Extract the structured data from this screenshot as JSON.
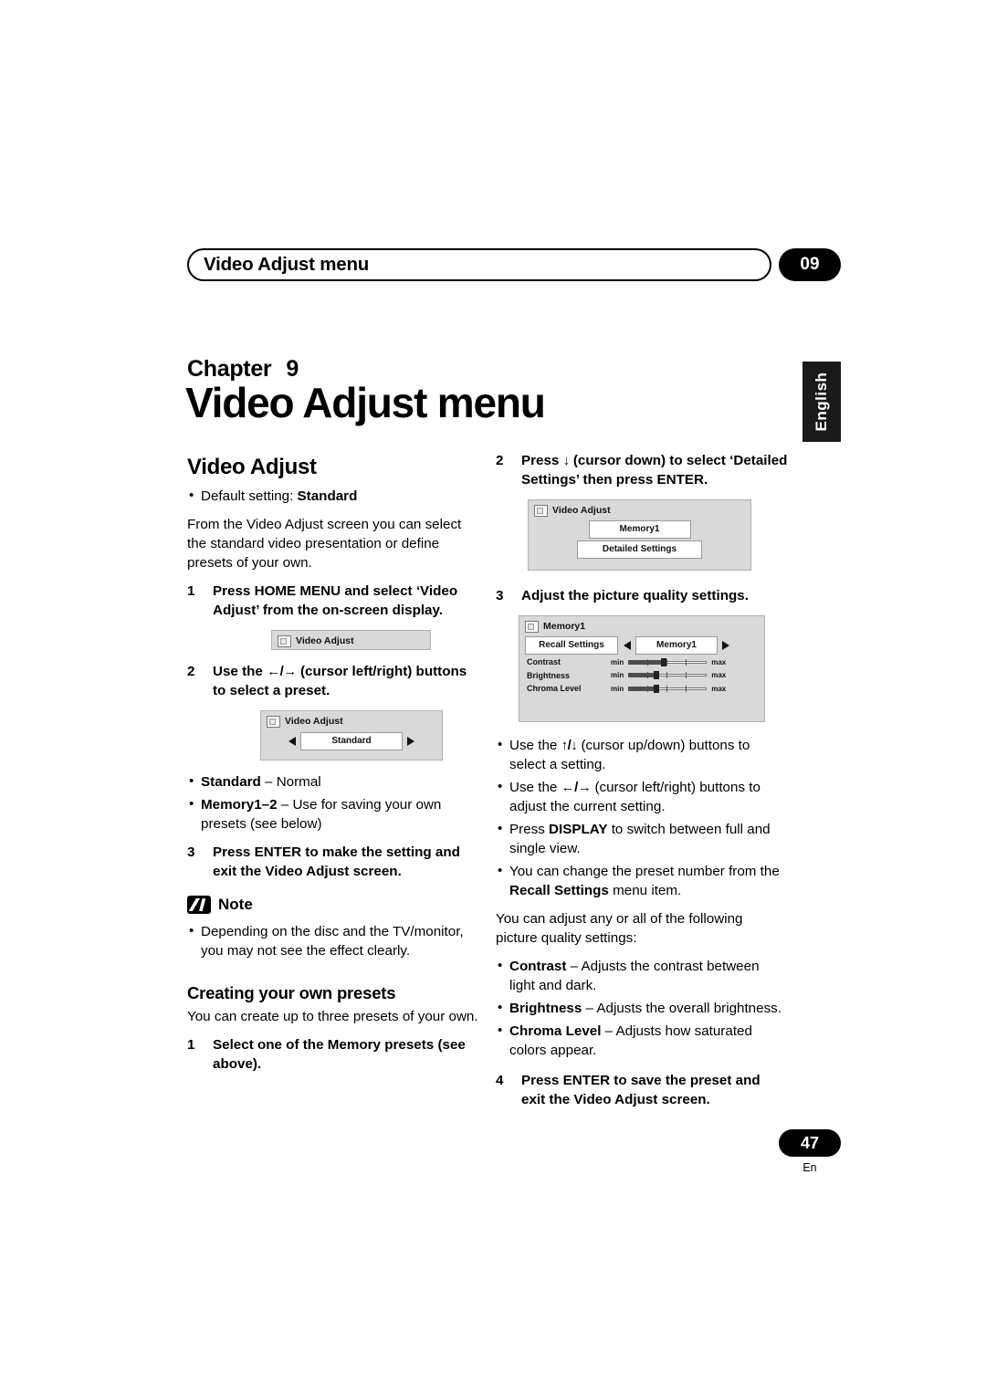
{
  "header": {
    "title": "Video Adjust menu",
    "chapter_number": "09"
  },
  "side_tab": {
    "label": "English"
  },
  "chapter": {
    "label": "Chapter",
    "number": "9",
    "title": "Video Adjust menu"
  },
  "left_column": {
    "section_title": "Video Adjust",
    "default_bullet_prefix": "Default setting: ",
    "default_bullet_value": "Standard",
    "intro": "From the Video Adjust screen you can select the standard video presentation or define presets of your own.",
    "step1_num": "1",
    "step1_text": "Press HOME MENU and select ‘Video Adjust’ from the on-screen display.",
    "osd1": {
      "title": "Video Adjust"
    },
    "step2_num": "2",
    "step2_text_a": "Use the ",
    "step2_arrows": "←/→",
    "step2_text_b": " (cursor left/right) buttons to select a preset.",
    "osd2": {
      "title": "Video Adjust",
      "field": "Standard"
    },
    "preset_bullets": [
      {
        "bold": "Standard",
        "rest": " – Normal"
      },
      {
        "bold": "Memory1–2",
        "rest": " – Use for saving your own presets (see below)"
      }
    ],
    "step3_num": "3",
    "step3_text": "Press ENTER to make the setting and exit the Video Adjust screen.",
    "note_title": "Note",
    "note_bullets": [
      "Depending on the disc and the TV/monitor, you may not see the effect clearly."
    ],
    "subsection_title": "Creating your own presets",
    "subsection_intro": "You can create up to three presets of your own.",
    "step4_num": "1",
    "step4_text": "Select one of the Memory presets (see above)."
  },
  "right_column": {
    "step1_num": "2",
    "step1_text_a": "Press ",
    "step1_arrow": "↓",
    "step1_text_b": " (cursor down) to select ‘Detailed Settings’ then press ENTER.",
    "osd1": {
      "title": "Video Adjust",
      "field1": "Memory1",
      "field2": "Detailed Settings"
    },
    "step2_num": "3",
    "step2_text": "Adjust the picture quality settings.",
    "osd2": {
      "title": "Memory1",
      "recall_label": "Recall Settings",
      "recall_value": "Memory1",
      "rows": [
        {
          "label": "Contrast",
          "min": "min",
          "max": "max",
          "value": 52
        },
        {
          "label": "Brightness",
          "min": "min",
          "max": "max",
          "value": 42
        },
        {
          "label": "Chroma Level",
          "min": "min",
          "max": "max",
          "value": 42
        }
      ]
    },
    "bullets": [
      {
        "text_a": "Use the ",
        "arrows": "↑/↓",
        "text_b": " (cursor up/down) buttons to select a setting."
      },
      {
        "text_a": "Use the ",
        "arrows": "←/→",
        "text_b": " (cursor left/right) buttons to adjust the current setting."
      },
      {
        "text_a": "Press ",
        "bold": "DISPLAY",
        "text_b": " to switch between full and single view."
      },
      {
        "text_a": "You can change the preset number from the ",
        "bold": "Recall Settings",
        "text_b": " menu item."
      }
    ],
    "adjust_intro": "You can adjust any or all of the following picture quality settings:",
    "setting_bullets": [
      {
        "bold": "Contrast",
        "rest": " – Adjusts the contrast between light and dark."
      },
      {
        "bold": "Brightness",
        "rest": " – Adjusts the overall brightness."
      },
      {
        "bold": "Chroma Level",
        "rest": " – Adjusts how saturated colors appear."
      }
    ],
    "step3_num": "4",
    "step3_text": "Press ENTER to save the preset and exit the Video Adjust screen."
  },
  "footer": {
    "page_number": "47",
    "language": "En"
  }
}
